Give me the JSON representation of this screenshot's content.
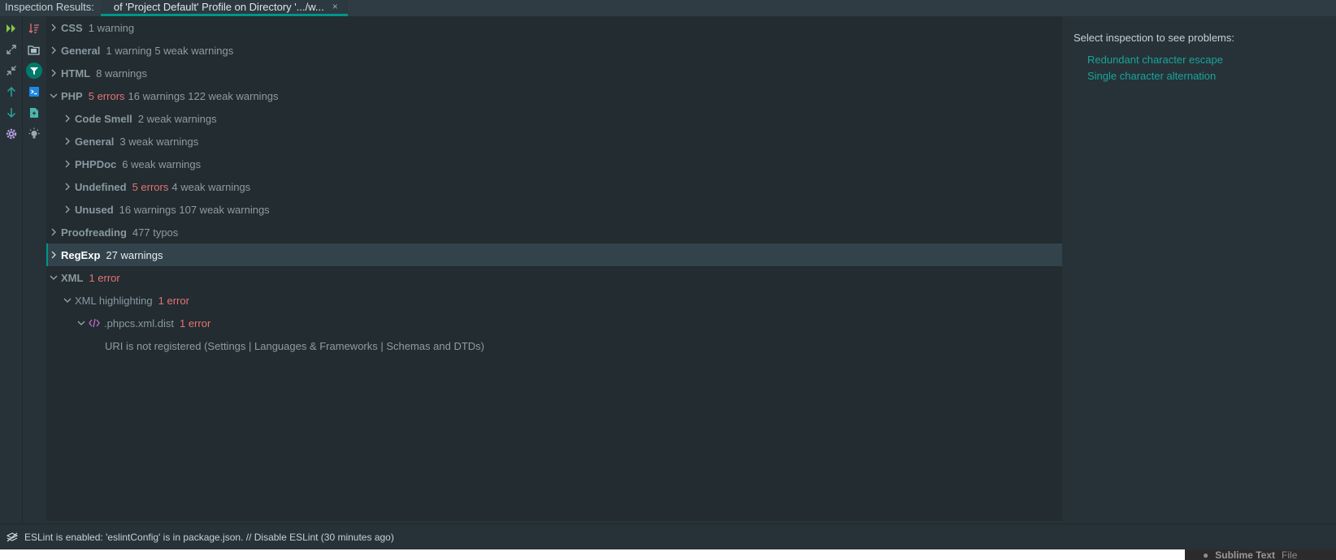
{
  "tabbar": {
    "title": "Inspection Results:",
    "tab_label": "of 'Project Default' Profile on Directory '.../w...",
    "close": "×"
  },
  "toolbar_left": [
    "rerun-icon",
    "expand-all-icon",
    "collapse-all-icon",
    "previous-occurrence-icon",
    "next-occurrence-icon",
    "settings-icon"
  ],
  "toolbar_right": [
    "group-by-severity-icon",
    "group-by-directory-icon",
    "filter-icon",
    "fix-icon",
    "export-icon",
    "quick-fix-bulb-icon"
  ],
  "tree": [
    {
      "label": "CSS",
      "error": "",
      "count": "1 warning"
    },
    {
      "label": "General",
      "error": "",
      "count": "1 warning 5 weak warnings"
    },
    {
      "label": "HTML",
      "error": "",
      "count": "8 warnings"
    },
    {
      "label": "PHP",
      "error": "5 errors",
      "count": "16 warnings 122 weak warnings"
    },
    {
      "label": "Code Smell",
      "error": "",
      "count": "2 weak warnings"
    },
    {
      "label": "General",
      "error": "",
      "count": "3 weak warnings"
    },
    {
      "label": "PHPDoc",
      "error": "",
      "count": "6 weak warnings"
    },
    {
      "label": "Undefined",
      "error": "5 errors",
      "count": "4 weak warnings"
    },
    {
      "label": "Unused",
      "error": "",
      "count": "16 warnings 107 weak warnings"
    },
    {
      "label": "Proofreading",
      "error": "",
      "count": "477 typos"
    },
    {
      "label": "RegExp",
      "error": "",
      "count": "27 warnings"
    },
    {
      "label": "XML",
      "error": "1 error",
      "count": ""
    },
    {
      "label": "XML highlighting",
      "error": "1 error",
      "count": ""
    },
    {
      "label": ".phpcs.xml.dist",
      "error": "1 error",
      "count": ""
    },
    {
      "label": "URI is not registered (Settings | Languages & Frameworks | Schemas and DTDs)"
    }
  ],
  "details": {
    "header": "Select inspection to see problems:",
    "links": [
      "Redundant character escape",
      "Single character alternation"
    ]
  },
  "status": {
    "message": "ESLint is enabled: 'eslintConfig' is in package.json. // Disable ESLint (30 minutes ago)"
  },
  "taskbar": {
    "app": "Sublime Text",
    "menu": "File"
  },
  "colors": {
    "accent": "#009688",
    "error": "#e57373",
    "link": "#1ba39c"
  }
}
